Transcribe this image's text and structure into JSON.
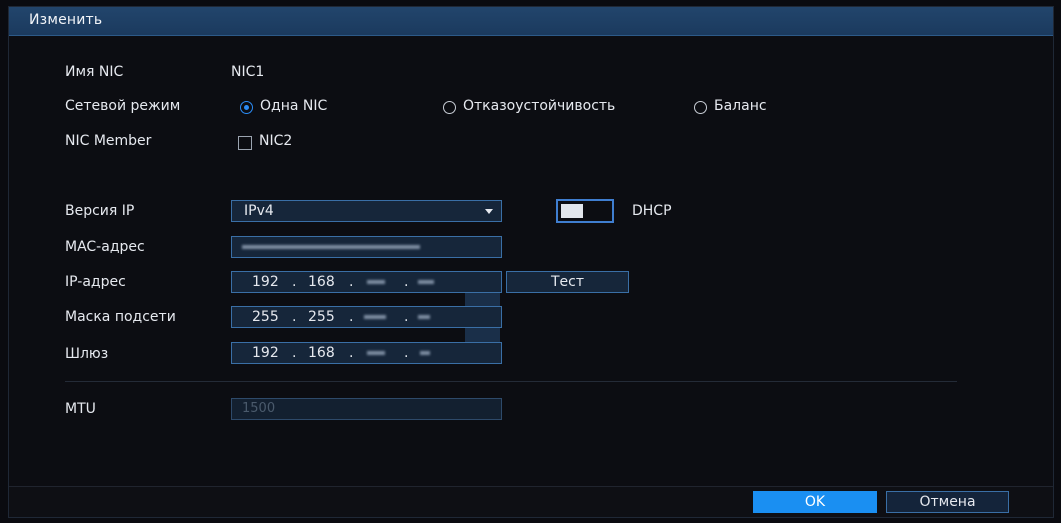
{
  "dialog": {
    "title": "Изменить"
  },
  "nic_name": {
    "label": "Имя NIC",
    "value": "NIC1"
  },
  "network_mode": {
    "label": "Сетевой режим",
    "options": [
      {
        "label": "Одна NIC",
        "selected": true
      },
      {
        "label": "Отказоустойчивость",
        "selected": false
      },
      {
        "label": "Баланс",
        "selected": false
      }
    ]
  },
  "nic_member": {
    "label": "NIC Member",
    "option_label": "NIC2",
    "checked": false
  },
  "ip_version": {
    "label": "Версия IP",
    "value": "IPv4",
    "dhcp_label": "DHCP",
    "dhcp_enabled": false
  },
  "mac": {
    "label": "MAC-адрес"
  },
  "ip_address": {
    "label": "IP-адрес",
    "octet1": "192",
    "octet2": "168",
    "test_button": "Тест"
  },
  "subnet_mask": {
    "label": "Маска подсети",
    "octet1": "255",
    "octet2": "255"
  },
  "gateway": {
    "label": "Шлюз",
    "octet1": "192",
    "octet2": "168"
  },
  "mtu": {
    "label": "MTU",
    "value": "1500"
  },
  "footer": {
    "ok_button": "OK",
    "cancel_button": "Отмена"
  },
  "colors": {
    "accent": "#1a8ff2",
    "title_bar": "#1b3a5e",
    "field_border": "#3a6fa6",
    "background": "#0c0d12"
  }
}
